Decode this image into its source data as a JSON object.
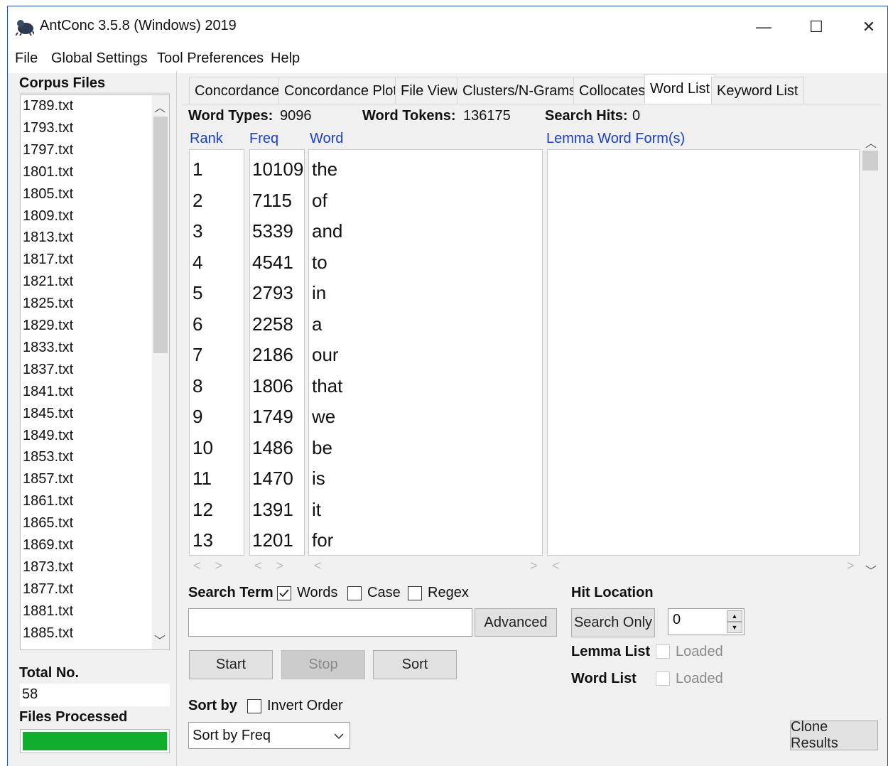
{
  "window": {
    "title": "AntConc 3.5.8 (Windows) 2019",
    "minimize": "—",
    "maximize": "☐",
    "close": "✕"
  },
  "menu": [
    "File",
    "Global Settings",
    "Tool Preferences",
    "Help"
  ],
  "corpus": {
    "header": "Corpus Files",
    "files": [
      "1789.txt",
      "1793.txt",
      "1797.txt",
      "1801.txt",
      "1805.txt",
      "1809.txt",
      "1813.txt",
      "1817.txt",
      "1821.txt",
      "1825.txt",
      "1829.txt",
      "1833.txt",
      "1837.txt",
      "1841.txt",
      "1845.txt",
      "1849.txt",
      "1853.txt",
      "1857.txt",
      "1861.txt",
      "1865.txt",
      "1869.txt",
      "1873.txt",
      "1877.txt",
      "1881.txt",
      "1885.txt"
    ],
    "total_label": "Total No.",
    "total_value": "58",
    "processed_label": "Files Processed",
    "progress": 1.0,
    "progress_color": "#11ad2c"
  },
  "tabs": [
    "Concordance",
    "Concordance Plot",
    "File View",
    "Clusters/N-Grams",
    "Collocates",
    "Word List",
    "Keyword List"
  ],
  "active_tab": "Word List",
  "stats": {
    "types_label": "Word Types:",
    "types_value": "9096",
    "tokens_label": "Word Tokens:",
    "tokens_value": "136175",
    "hits_label": "Search Hits:",
    "hits_value": "0"
  },
  "columns": {
    "rank": "Rank",
    "freq": "Freq",
    "word": "Word",
    "lemma": "Lemma Word Form(s)"
  },
  "rows": [
    {
      "rank": "1",
      "freq": "10109",
      "word": "the"
    },
    {
      "rank": "2",
      "freq": "7115",
      "word": "of"
    },
    {
      "rank": "3",
      "freq": "5339",
      "word": "and"
    },
    {
      "rank": "4",
      "freq": "4541",
      "word": "to"
    },
    {
      "rank": "5",
      "freq": "2793",
      "word": "in"
    },
    {
      "rank": "6",
      "freq": "2258",
      "word": "a"
    },
    {
      "rank": "7",
      "freq": "2186",
      "word": "our"
    },
    {
      "rank": "8",
      "freq": "1806",
      "word": "that"
    },
    {
      "rank": "9",
      "freq": "1749",
      "word": "we"
    },
    {
      "rank": "10",
      "freq": "1486",
      "word": "be"
    },
    {
      "rank": "11",
      "freq": "1470",
      "word": "is"
    },
    {
      "rank": "12",
      "freq": "1391",
      "word": "it"
    },
    {
      "rank": "13",
      "freq": "1201",
      "word": "for"
    }
  ],
  "search": {
    "term_label": "Search Term",
    "words_label": "Words",
    "words_checked": true,
    "case_label": "Case",
    "case_checked": false,
    "regex_label": "Regex",
    "regex_checked": false,
    "value": "",
    "advanced": "Advanced"
  },
  "buttons": {
    "start": "Start",
    "stop": "Stop",
    "sort": "Sort",
    "clone": "Clone Results"
  },
  "hit_location": {
    "label": "Hit Location",
    "search_only": "Search Only",
    "value": "0"
  },
  "lemma_list": {
    "label": "Lemma List",
    "status": "Loaded"
  },
  "word_list": {
    "label": "Word List",
    "status": "Loaded"
  },
  "sort": {
    "label": "Sort by",
    "invert_label": "Invert Order",
    "selected": "Sort by Freq"
  }
}
